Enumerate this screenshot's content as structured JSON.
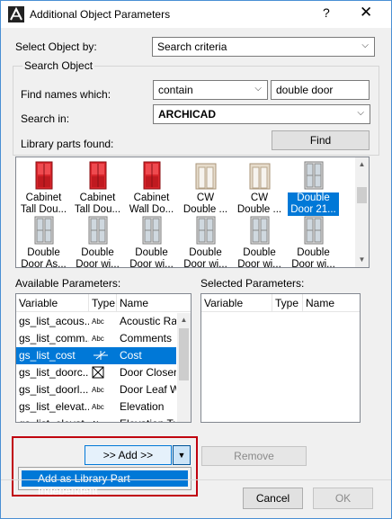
{
  "window": {
    "title": "Additional Object Parameters",
    "help_glyph": "?",
    "close_glyph": "✕"
  },
  "select_by": {
    "label": "Select Object by:",
    "value": "Search criteria"
  },
  "search_object": {
    "group_label": "Search Object",
    "find_names_label": "Find names which:",
    "match_mode": "contain",
    "search_text": "double door",
    "search_in_label": "Search in:",
    "search_in_value": "ARCHICAD",
    "found_label": "Library parts found:",
    "find_button": "Find"
  },
  "library_parts": [
    {
      "l1": "Cabinet",
      "l2": "Tall Dou...",
      "icon": "red-tall-cabinet-icon",
      "selected": false
    },
    {
      "l1": "Cabinet",
      "l2": "Tall Dou...",
      "icon": "red-shelf-cabinet-icon",
      "selected": false
    },
    {
      "l1": "Cabinet",
      "l2": "Wall Do...",
      "icon": "red-wall-cabinet-icon",
      "selected": false
    },
    {
      "l1": "CW",
      "l2": "Double ...",
      "icon": "cw-double-door-icon",
      "selected": false
    },
    {
      "l1": "CW",
      "l2": "Double ...",
      "icon": "cw-double-door-arched-icon",
      "selected": false
    },
    {
      "l1": "Double",
      "l2": "Door 21...",
      "icon": "double-door-21-icon",
      "selected": true
    },
    {
      "l1": "Double",
      "l2": "Door As...",
      "icon": "double-door-icon",
      "selected": false
    },
    {
      "l1": "Double",
      "l2": "Door wi...",
      "icon": "double-door-icon",
      "selected": false
    },
    {
      "l1": "Double",
      "l2": "Door wi...",
      "icon": "double-door-icon",
      "selected": false
    },
    {
      "l1": "Double",
      "l2": "Door wi...",
      "icon": "double-door-icon",
      "selected": false
    },
    {
      "l1": "Double",
      "l2": "Door wi...",
      "icon": "double-door-icon",
      "selected": false
    },
    {
      "l1": "Double",
      "l2": "Door wi...",
      "icon": "double-door-icon",
      "selected": false
    }
  ],
  "available": {
    "label": "Available Parameters:",
    "headers": [
      "Variable",
      "Type",
      "Name"
    ],
    "rows": [
      {
        "variable": "gs_list_acous...",
        "type": "Abc",
        "name": "Acoustic Rat",
        "selected": false
      },
      {
        "variable": "gs_list_comm...",
        "type": "Abc",
        "name": "Comments",
        "selected": false
      },
      {
        "variable": "gs_list_cost",
        "type": "cost-icon",
        "name": "Cost",
        "selected": true
      },
      {
        "variable": "gs_list_doorc...",
        "type": "checkbox-icon",
        "name": "Door Closer",
        "selected": false
      },
      {
        "variable": "gs_list_doorl...",
        "type": "Abc",
        "name": "Door Leaf W",
        "selected": false
      },
      {
        "variable": "gs_list_elevat...",
        "type": "Abc",
        "name": "Elevation",
        "selected": false
      },
      {
        "variable": "gs_list_elevat...",
        "type": "Abc",
        "name": "Elevation Tu",
        "selected": false
      }
    ]
  },
  "selected_params": {
    "label": "Selected Parameters:",
    "headers": [
      "Variable",
      "Type",
      "Name"
    ]
  },
  "actions": {
    "add": ">> Add >>",
    "remove": "Remove",
    "menu_item": "Add as Library Part Independent",
    "cancel": "Cancel",
    "ok": "OK"
  },
  "colors": {
    "accent": "#0078d7",
    "highlight": "#c0000e"
  }
}
